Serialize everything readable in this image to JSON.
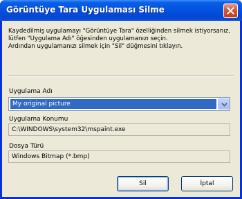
{
  "window": {
    "title": "Görüntüye Tara Uygulaması Silme"
  },
  "description": {
    "line1": "Kaydedilmiş uygulamayı \"Görüntüye Tara\" özelliğinden silmek istiyorsanız,",
    "line2": "lütfen \"Uygulama Adı\" öğesinden uygulamanızı seçin.",
    "line3": "Ardından uygulamanızı silmek için \"Sil\" düğmesini tıklayın."
  },
  "app_name": {
    "label": "Uygulama Adı",
    "selected": "My original picture"
  },
  "app_location": {
    "label": "Uygulama Konumu",
    "value": "C:\\WINDOWS\\system32\\mspaint.exe"
  },
  "file_type": {
    "label": "Dosya Türü",
    "value": "Windows Bitmap (*.bmp)"
  },
  "buttons": {
    "delete": "Sil",
    "cancel": "İptal"
  },
  "colors": {
    "titlebar": "#0453e0",
    "selection": "#316ac5",
    "dialog_bg": "#ece9d8",
    "close_button": "#c63c1c"
  },
  "icons": {
    "close": "close-icon",
    "dropdown": "chevron-down-icon"
  }
}
